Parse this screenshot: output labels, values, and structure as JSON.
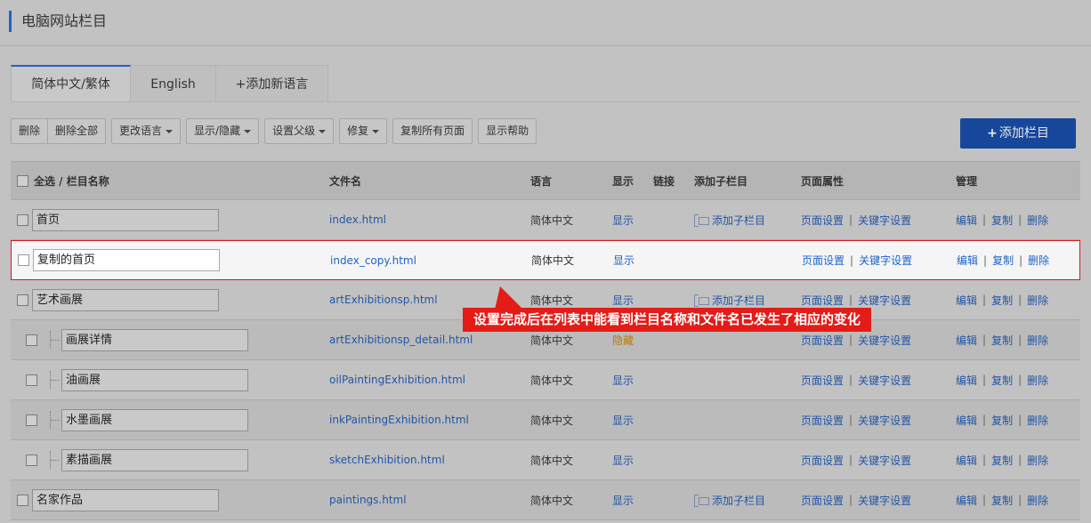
{
  "page": {
    "title": "电脑网站栏目"
  },
  "tabs": [
    {
      "label": "简体中文/繁体",
      "active": true
    },
    {
      "label": "English",
      "active": false
    },
    {
      "label": "+添加新语言",
      "active": false
    }
  ],
  "toolbar": {
    "delete": "删除",
    "delete_all": "删除全部",
    "change_lang": "更改语言",
    "show_hide": "显示/隐藏",
    "set_parent": "设置父级",
    "repair": "修复",
    "copy_all": "复制所有页面",
    "show_help": "显示帮助"
  },
  "add_column_label": "添加栏目",
  "table": {
    "headers": {
      "select_all": "全选 / 栏目名称",
      "filename": "文件名",
      "language": "语言",
      "display": "显示",
      "link": "链接",
      "add_child": "添加子栏目",
      "page_props": "页面属性",
      "manage": "管理"
    },
    "actions": {
      "add_child": "添加子栏目",
      "page_settings": "页面设置",
      "keyword_settings": "关键字设置",
      "edit": "编辑",
      "copy": "复制",
      "delete": "删除",
      "separator": "|"
    },
    "rows": [
      {
        "name": "首页",
        "file": "index.html",
        "lang": "简体中文",
        "display": "显示",
        "child": false
      },
      {
        "name": "复制的首页",
        "file": "index_copy.html",
        "lang": "简体中文",
        "display": "显示",
        "child": false
      },
      {
        "name": "艺术画展",
        "file": "artExhibitionsp.html",
        "lang": "简体中文",
        "display": "显示",
        "child": false
      },
      {
        "name": "画展详情",
        "file": "artExhibitionsp_detail.html",
        "lang": "简体中文",
        "display": "隐藏",
        "child": true
      },
      {
        "name": "油画展",
        "file": "oilPaintingExhibition.html",
        "lang": "简体中文",
        "display": "显示",
        "child": true
      },
      {
        "name": "水墨画展",
        "file": "inkPaintingExhibition.html",
        "lang": "简体中文",
        "display": "显示",
        "child": true
      },
      {
        "name": "素描画展",
        "file": "sketchExhibition.html",
        "lang": "简体中文",
        "display": "显示",
        "child": true
      },
      {
        "name": "名家作品",
        "file": "paintings.html",
        "lang": "简体中文",
        "display": "显示",
        "child": false
      }
    ]
  },
  "callout": {
    "text": "设置完成后在列表中能看到栏目名称和文件名已发生了相应的变化"
  },
  "colors": {
    "accent": "#1e63c7",
    "primary_button": "#17479b",
    "highlight_border": "#e0141c",
    "callout": "#e41b17",
    "hidden_status": "#b8780a"
  }
}
